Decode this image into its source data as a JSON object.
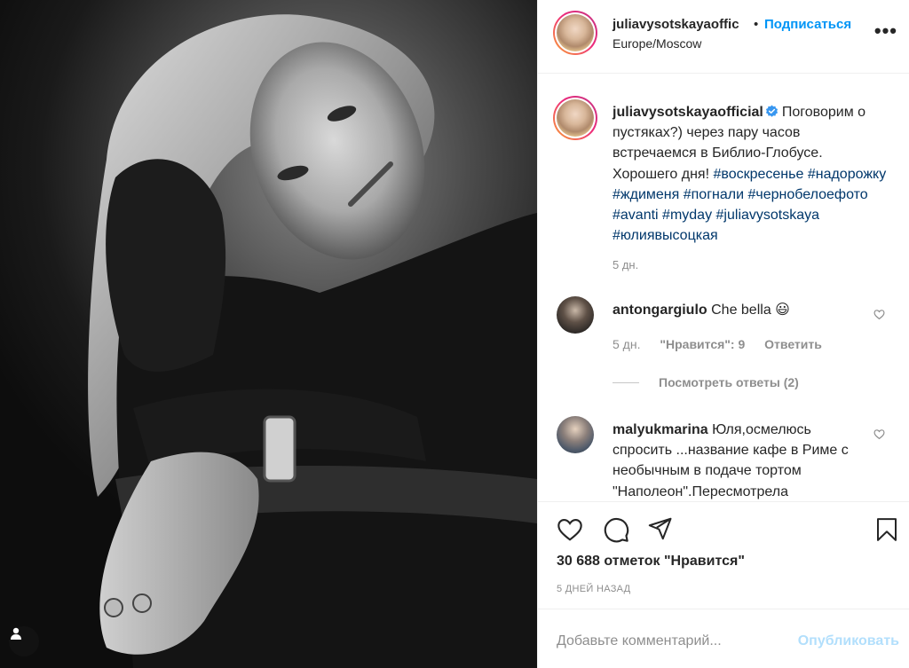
{
  "header": {
    "username": "juliavysotskayaoffic",
    "separator": "•",
    "follow_label": "Подписаться",
    "location": "Europe/Moscow",
    "more_label": "•••"
  },
  "caption": {
    "username": "juliavysotskayaofficial",
    "text": "Поговорим о пустяках?) через пару часов встречаемся в Библио-Глобусе. Хорошего дня!",
    "hashtags": [
      "#воскресенье",
      "#надорожку",
      "#ждименя",
      "#погнали",
      "#чернобелоефото",
      "#avanti",
      "#myday",
      "#juliavysotskaya",
      "#юлиявысоцкая"
    ],
    "time": "5 дн."
  },
  "comments": [
    {
      "username": "antongargiulo",
      "text": "Che bella",
      "emoji": "😃",
      "time": "5 дн.",
      "likes": "\"Нравится\": 9",
      "reply_label": "Ответить",
      "view_replies": "Посмотреть ответы (2)"
    },
    {
      "username": "malyukmarina",
      "text": "Юля,осмелюсь спросить ...название кафе в Риме с необычным в подаче тортом \"Наполеон\".Пересмотрела"
    }
  ],
  "actions": {
    "likes_count": "30 688 отметок \"Нравится\"",
    "date": "5 ДНЕЙ НАЗАД"
  },
  "add_comment": {
    "placeholder": "Добавьте комментарий...",
    "publish_label": "Опубликовать"
  },
  "colors": {
    "link_blue": "#0095f6",
    "hashtag": "#00376b",
    "muted": "#8e8e8e",
    "publish_disabled": "#b2dffc"
  }
}
